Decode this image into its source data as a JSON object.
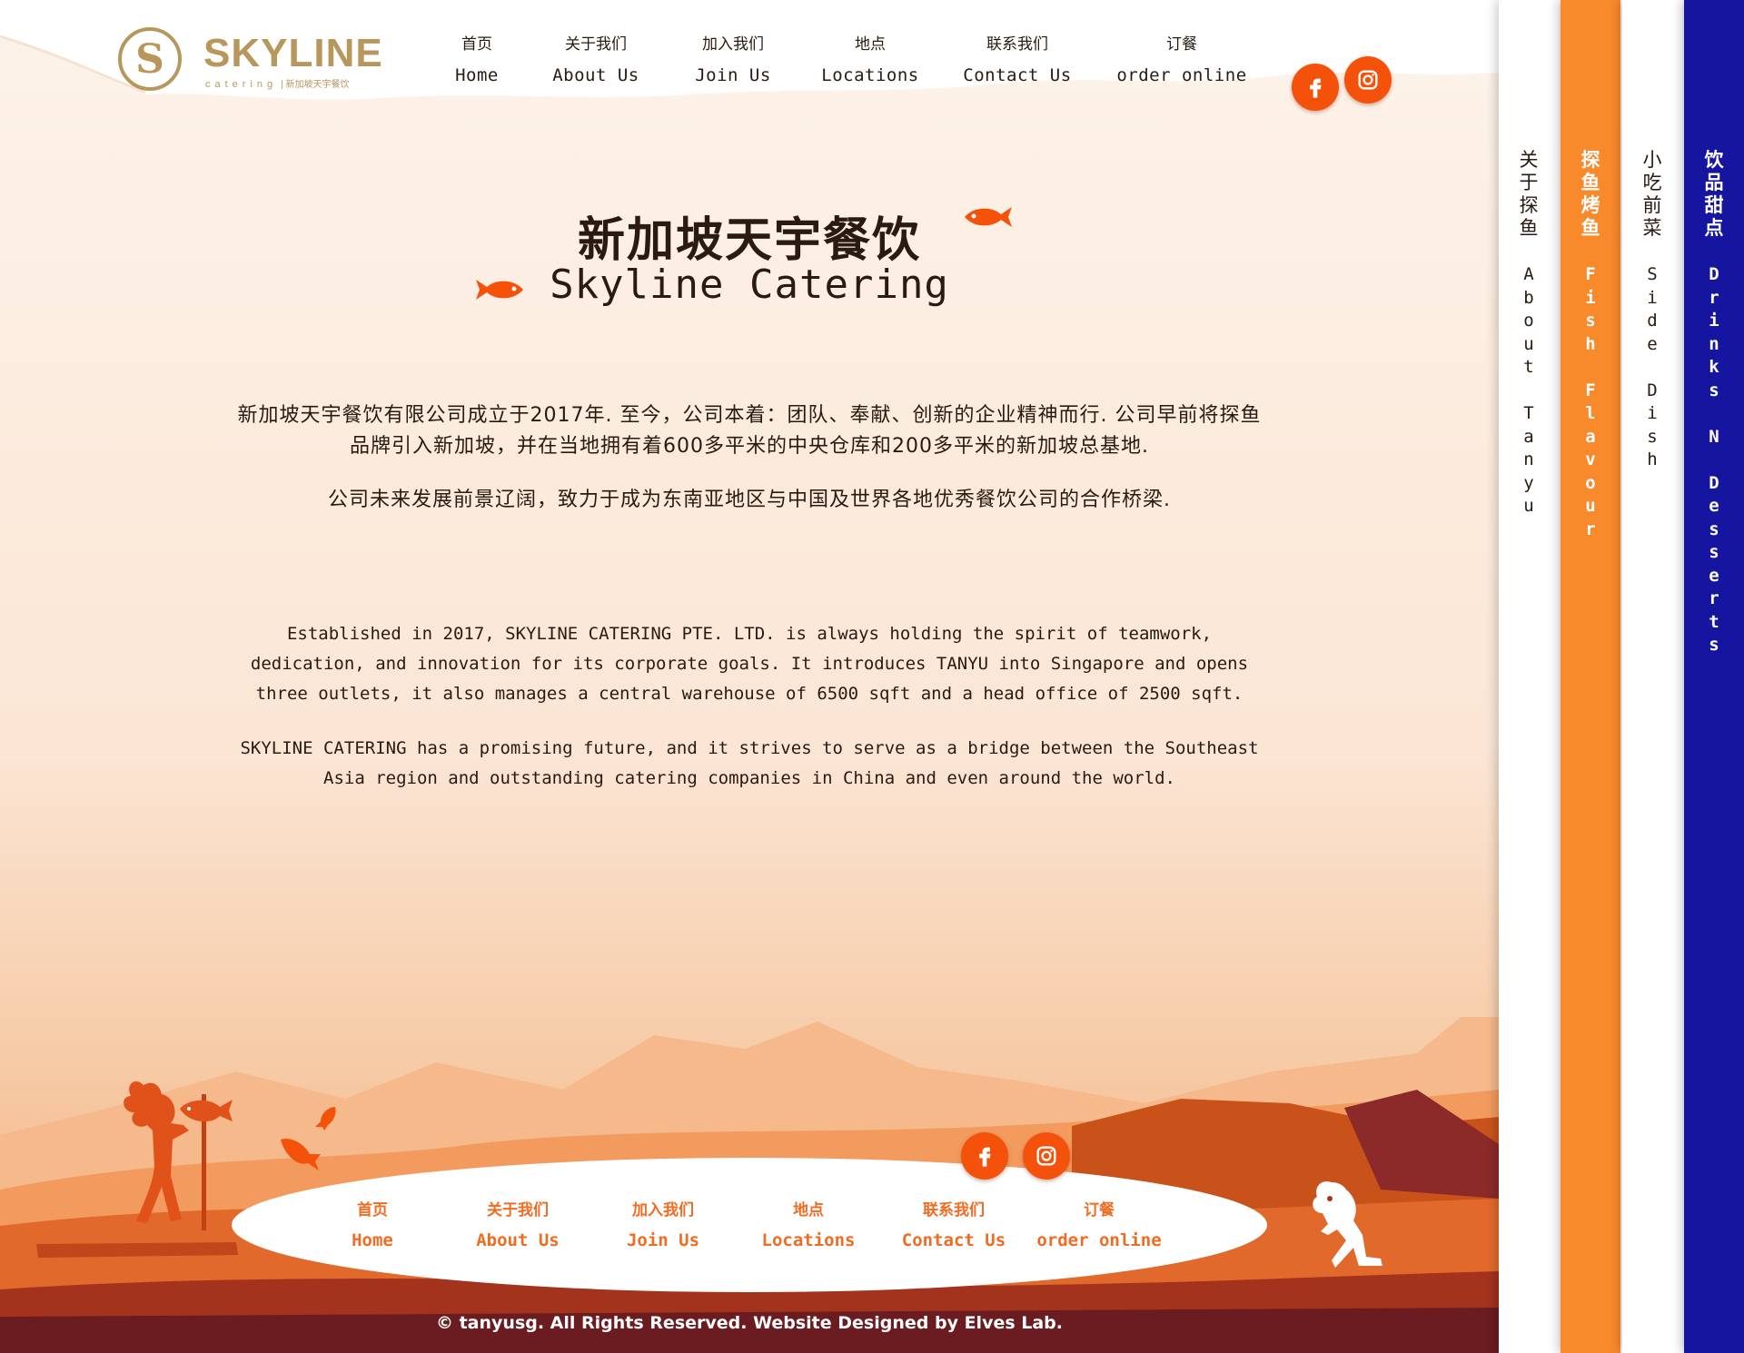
{
  "brand": {
    "logo_letter": "S",
    "name": "SKYLINE",
    "sub": "catering",
    "sub_cn": "| 新加坡天宇餐饮"
  },
  "nav": [
    {
      "cn": "首页",
      "en": "Home",
      "icon": "home-icon"
    },
    {
      "cn": "关于我们",
      "en": "About Us",
      "icon": "fish-icon"
    },
    {
      "cn": "加入我们",
      "en": "Join Us",
      "icon": "people-icon"
    },
    {
      "cn": "地点",
      "en": "Locations",
      "icon": "map-icon"
    },
    {
      "cn": "联系我们",
      "en": "Contact Us",
      "icon": "phone-icon"
    },
    {
      "cn": "订餐",
      "en": "order online",
      "icon": "utensils-icon"
    }
  ],
  "social": [
    {
      "name": "facebook-icon"
    },
    {
      "name": "instagram-icon"
    }
  ],
  "hero": {
    "title_cn": "新加坡天宇餐饮",
    "title_en": "Skyline Catering"
  },
  "about": {
    "cn_p1": "新加坡天宇餐饮有限公司成立于2017年. 至今，公司本着：团队、奉献、创新的企业精神而行. 公司早前将探鱼品牌引入新加坡，并在当地拥有着600多平米的中央仓库和200多平米的新加坡总基地.",
    "cn_p2": "公司未来发展前景辽阔，致力于成为东南亚地区与中国及世界各地优秀餐饮公司的合作桥梁.",
    "en_p1": "Established in 2017, SKYLINE CATERING PTE. LTD. is always holding the spirit of teamwork, dedication, and innovation for its corporate goals. It introduces TANYU into Singapore and opens three outlets, it also manages a central warehouse of 6500 sqft and a head office of 2500 sqft.",
    "en_p2": "SKYLINE CATERING has a promising future, and it strives to serve as a bridge between the Southeast Asia region and outstanding catering companies in China and even around the world."
  },
  "footer": {
    "nav": [
      {
        "cn": "首页",
        "en": "Home"
      },
      {
        "cn": "关于我们",
        "en": "About Us"
      },
      {
        "cn": "加入我们",
        "en": "Join Us"
      },
      {
        "cn": "地点",
        "en": "Locations"
      },
      {
        "cn": "联系我们",
        "en": "Contact Us"
      },
      {
        "cn": "订餐",
        "en": "order online"
      }
    ],
    "copyright": "© tanyusg. All Rights Reserved. Website Designed by Elves Lab."
  },
  "side_panels": [
    {
      "cn": "关于探鱼",
      "en": "About Tanyu",
      "bg": "#ffffff",
      "fg": "#2a1a12"
    },
    {
      "cn": "探鱼烤鱼",
      "en": "Fish Flavour",
      "bg": "#f98a2c",
      "fg": "#ffffff"
    },
    {
      "cn": "小吃前菜",
      "en": "Side Dish",
      "bg": "#ffffff",
      "fg": "#2a1a12"
    },
    {
      "cn": "饮品甜点",
      "en": "Drinks N Desserts",
      "bg": "#1515a0",
      "fg": "#ffffff"
    }
  ],
  "colors": {
    "accent": "#f4520a",
    "brand_gold": "#b8975c",
    "footer_dark": "#6a1c20"
  }
}
